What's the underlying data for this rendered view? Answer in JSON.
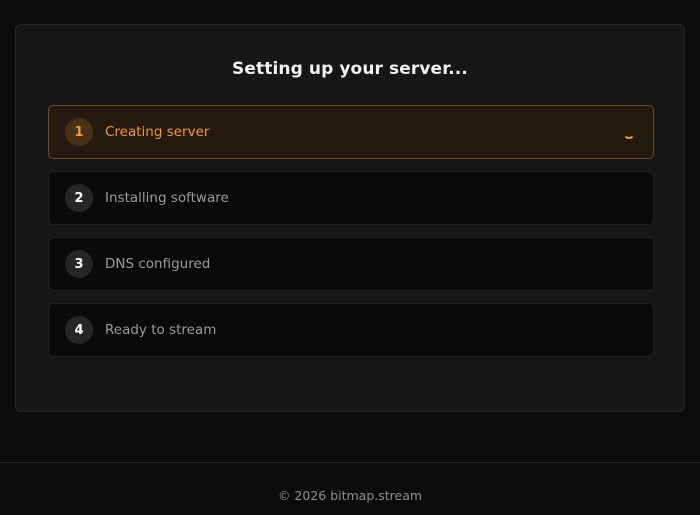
{
  "page": {
    "title": "Setting up your server..."
  },
  "steps": [
    {
      "number": "1",
      "label": "Creating server",
      "status": "in-progress"
    },
    {
      "number": "2",
      "label": "Installing software",
      "status": "pending"
    },
    {
      "number": "3",
      "label": "DNS configured",
      "status": "pending"
    },
    {
      "number": "4",
      "label": "Ready to stream",
      "status": "pending"
    }
  ],
  "footer": {
    "text": "© 2026 bitmap.stream"
  },
  "colors": {
    "background": "#0b0b0b",
    "card": "#161616",
    "accent": "#f39a3a",
    "active_step_bg": "#241a10",
    "active_step_border": "#6b4a23",
    "muted_text": "#9a9a9a"
  }
}
